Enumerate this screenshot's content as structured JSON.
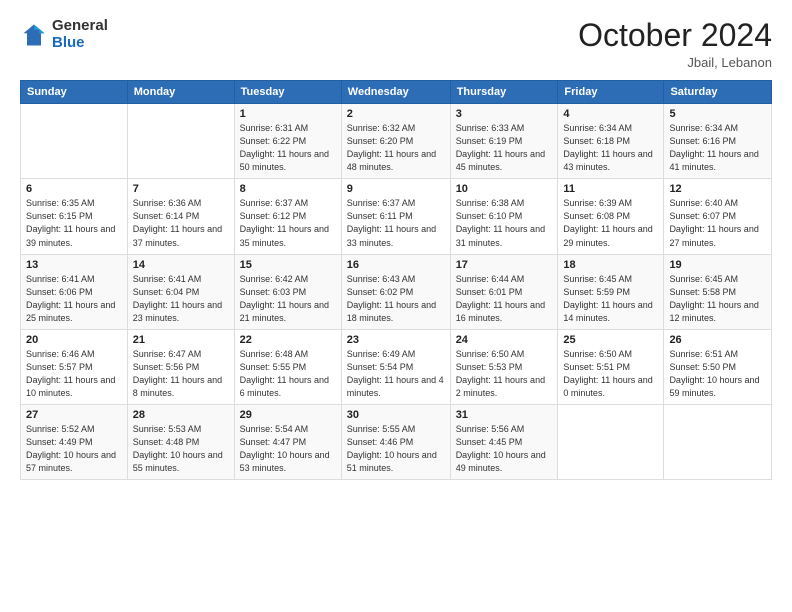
{
  "header": {
    "logo": {
      "line1": "General",
      "line2": "Blue"
    },
    "title": "October 2024",
    "location": "Jbail, Lebanon"
  },
  "weekdays": [
    "Sunday",
    "Monday",
    "Tuesday",
    "Wednesday",
    "Thursday",
    "Friday",
    "Saturday"
  ],
  "weeks": [
    [
      {
        "day": "",
        "info": ""
      },
      {
        "day": "",
        "info": ""
      },
      {
        "day": "1",
        "info": "Sunrise: 6:31 AM\nSunset: 6:22 PM\nDaylight: 11 hours and 50 minutes."
      },
      {
        "day": "2",
        "info": "Sunrise: 6:32 AM\nSunset: 6:20 PM\nDaylight: 11 hours and 48 minutes."
      },
      {
        "day": "3",
        "info": "Sunrise: 6:33 AM\nSunset: 6:19 PM\nDaylight: 11 hours and 45 minutes."
      },
      {
        "day": "4",
        "info": "Sunrise: 6:34 AM\nSunset: 6:18 PM\nDaylight: 11 hours and 43 minutes."
      },
      {
        "day": "5",
        "info": "Sunrise: 6:34 AM\nSunset: 6:16 PM\nDaylight: 11 hours and 41 minutes."
      }
    ],
    [
      {
        "day": "6",
        "info": "Sunrise: 6:35 AM\nSunset: 6:15 PM\nDaylight: 11 hours and 39 minutes."
      },
      {
        "day": "7",
        "info": "Sunrise: 6:36 AM\nSunset: 6:14 PM\nDaylight: 11 hours and 37 minutes."
      },
      {
        "day": "8",
        "info": "Sunrise: 6:37 AM\nSunset: 6:12 PM\nDaylight: 11 hours and 35 minutes."
      },
      {
        "day": "9",
        "info": "Sunrise: 6:37 AM\nSunset: 6:11 PM\nDaylight: 11 hours and 33 minutes."
      },
      {
        "day": "10",
        "info": "Sunrise: 6:38 AM\nSunset: 6:10 PM\nDaylight: 11 hours and 31 minutes."
      },
      {
        "day": "11",
        "info": "Sunrise: 6:39 AM\nSunset: 6:08 PM\nDaylight: 11 hours and 29 minutes."
      },
      {
        "day": "12",
        "info": "Sunrise: 6:40 AM\nSunset: 6:07 PM\nDaylight: 11 hours and 27 minutes."
      }
    ],
    [
      {
        "day": "13",
        "info": "Sunrise: 6:41 AM\nSunset: 6:06 PM\nDaylight: 11 hours and 25 minutes."
      },
      {
        "day": "14",
        "info": "Sunrise: 6:41 AM\nSunset: 6:04 PM\nDaylight: 11 hours and 23 minutes."
      },
      {
        "day": "15",
        "info": "Sunrise: 6:42 AM\nSunset: 6:03 PM\nDaylight: 11 hours and 21 minutes."
      },
      {
        "day": "16",
        "info": "Sunrise: 6:43 AM\nSunset: 6:02 PM\nDaylight: 11 hours and 18 minutes."
      },
      {
        "day": "17",
        "info": "Sunrise: 6:44 AM\nSunset: 6:01 PM\nDaylight: 11 hours and 16 minutes."
      },
      {
        "day": "18",
        "info": "Sunrise: 6:45 AM\nSunset: 5:59 PM\nDaylight: 11 hours and 14 minutes."
      },
      {
        "day": "19",
        "info": "Sunrise: 6:45 AM\nSunset: 5:58 PM\nDaylight: 11 hours and 12 minutes."
      }
    ],
    [
      {
        "day": "20",
        "info": "Sunrise: 6:46 AM\nSunset: 5:57 PM\nDaylight: 11 hours and 10 minutes."
      },
      {
        "day": "21",
        "info": "Sunrise: 6:47 AM\nSunset: 5:56 PM\nDaylight: 11 hours and 8 minutes."
      },
      {
        "day": "22",
        "info": "Sunrise: 6:48 AM\nSunset: 5:55 PM\nDaylight: 11 hours and 6 minutes."
      },
      {
        "day": "23",
        "info": "Sunrise: 6:49 AM\nSunset: 5:54 PM\nDaylight: 11 hours and 4 minutes."
      },
      {
        "day": "24",
        "info": "Sunrise: 6:50 AM\nSunset: 5:53 PM\nDaylight: 11 hours and 2 minutes."
      },
      {
        "day": "25",
        "info": "Sunrise: 6:50 AM\nSunset: 5:51 PM\nDaylight: 11 hours and 0 minutes."
      },
      {
        "day": "26",
        "info": "Sunrise: 6:51 AM\nSunset: 5:50 PM\nDaylight: 10 hours and 59 minutes."
      }
    ],
    [
      {
        "day": "27",
        "info": "Sunrise: 5:52 AM\nSunset: 4:49 PM\nDaylight: 10 hours and 57 minutes."
      },
      {
        "day": "28",
        "info": "Sunrise: 5:53 AM\nSunset: 4:48 PM\nDaylight: 10 hours and 55 minutes."
      },
      {
        "day": "29",
        "info": "Sunrise: 5:54 AM\nSunset: 4:47 PM\nDaylight: 10 hours and 53 minutes."
      },
      {
        "day": "30",
        "info": "Sunrise: 5:55 AM\nSunset: 4:46 PM\nDaylight: 10 hours and 51 minutes."
      },
      {
        "day": "31",
        "info": "Sunrise: 5:56 AM\nSunset: 4:45 PM\nDaylight: 10 hours and 49 minutes."
      },
      {
        "day": "",
        "info": ""
      },
      {
        "day": "",
        "info": ""
      }
    ]
  ]
}
